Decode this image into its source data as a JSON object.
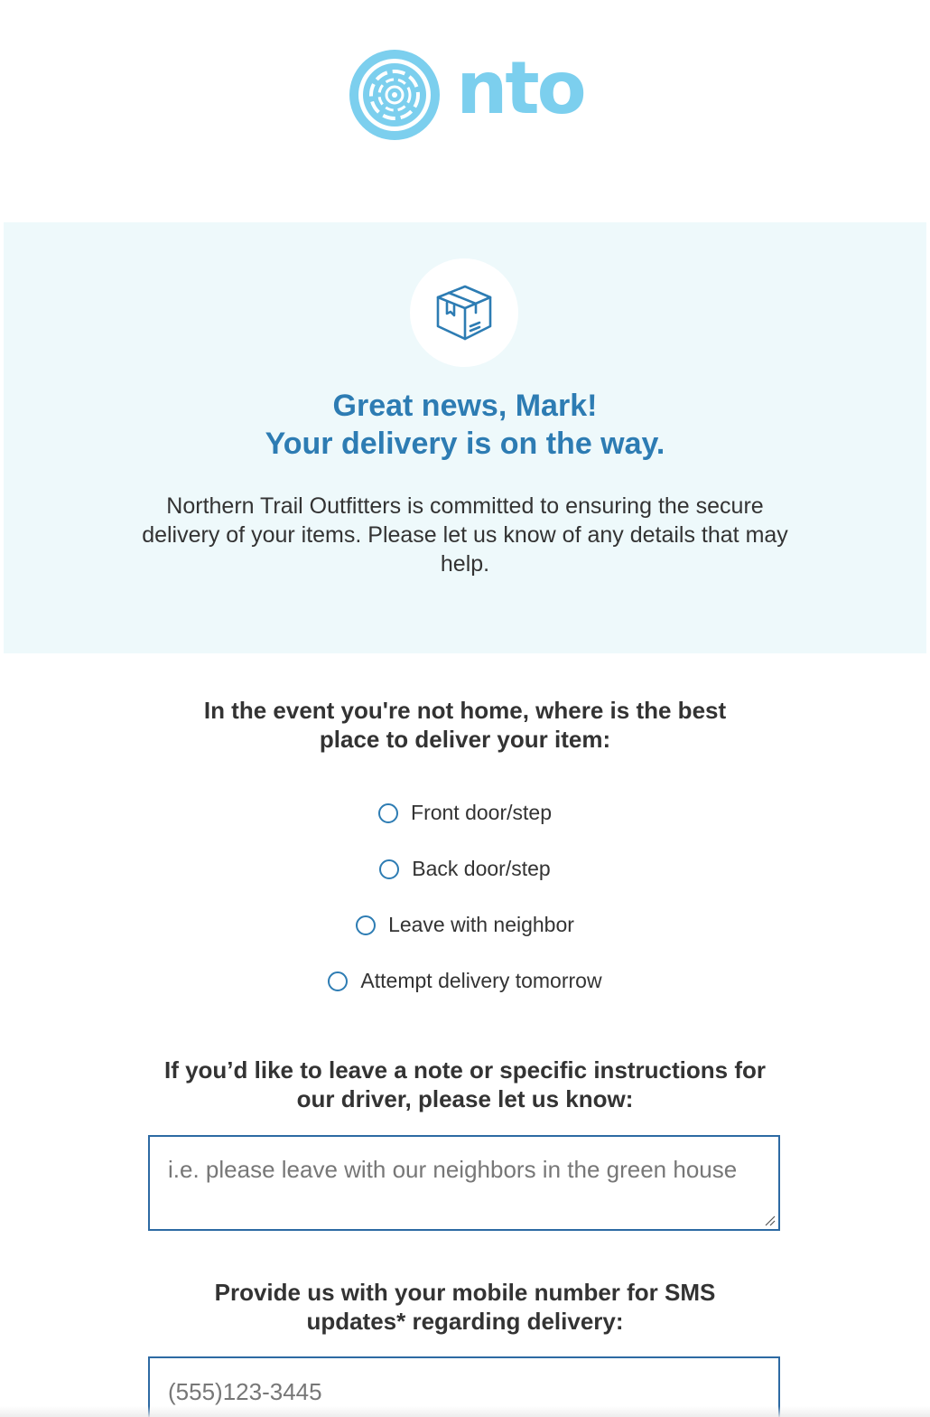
{
  "brand": {
    "logo_text": "nto",
    "icon": "nto-swirl-logo-icon",
    "color": "#7ccfee"
  },
  "hero": {
    "icon": "package-box-icon",
    "title_line1": "Great news, Mark!",
    "title_line2": "Your delivery is on the way.",
    "body": "Northern Trail Outfitters is committed to ensuring the secure delivery of your items. Please let us know of any details that may help.",
    "background": "#eef9fb",
    "accent": "#2d7cb3"
  },
  "delivery_location": {
    "question": "In the event you're not home, where is the best place to deliver your item:",
    "options": [
      {
        "label": "Front door/step",
        "selected": false
      },
      {
        "label": "Back door/step",
        "selected": false
      },
      {
        "label": "Leave with neighbor",
        "selected": false
      },
      {
        "label": "Attempt delivery tomorrow",
        "selected": false
      }
    ]
  },
  "driver_note": {
    "question": "If you’d like to leave a note or specific instructions for our driver, please let us know:",
    "value": "",
    "placeholder": "i.e. please leave with our neighbors in the green house"
  },
  "sms": {
    "question": "Provide us with your mobile number for SMS updates* regarding delivery:",
    "value": "",
    "placeholder": "(555)123-3445"
  }
}
